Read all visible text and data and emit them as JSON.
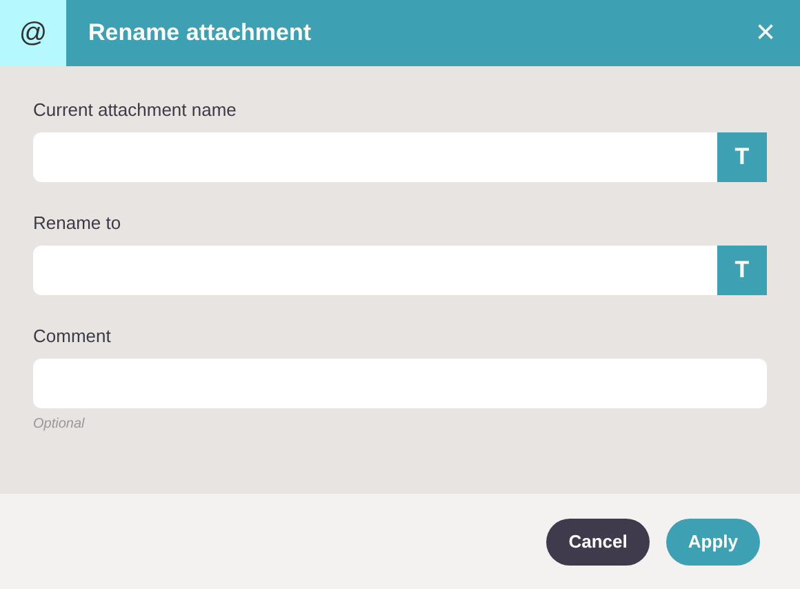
{
  "window": {
    "title": "Rename attachment",
    "close": "×",
    "app_icon": "@"
  },
  "fields": [
    {
      "label": "Current attachment name",
      "kind": "with_button",
      "button": "T"
    },
    {
      "label": "Rename to",
      "kind": "with_button",
      "button": "T"
    },
    {
      "label": "Comment",
      "kind": "plain",
      "hint": "Optional"
    }
  ],
  "buttons": [
    {
      "label": "Cancel",
      "kind": "secondary"
    },
    {
      "label": "Apply",
      "kind": "primary"
    }
  ]
}
